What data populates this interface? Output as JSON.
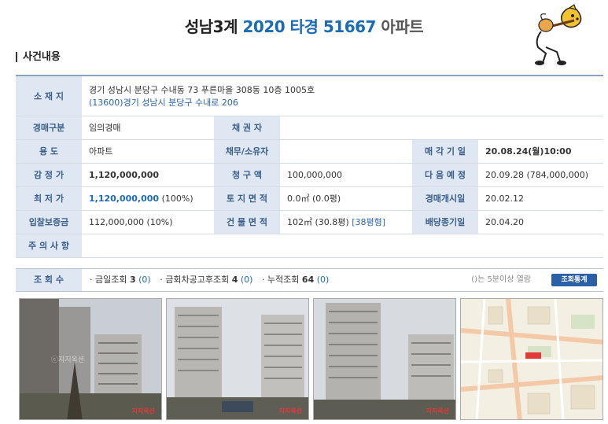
{
  "header": {
    "title_part1": "성남3계",
    "title_part2": "2020 타경 51667",
    "title_part3": "아파트"
  },
  "section_title": "사건내용",
  "info": {
    "location_label": "소 재 지",
    "location_line1": "경기 성남시 분당구 수내동 73 푸른마을 308동 10층 1005호",
    "location_line2": "(13600)경기 성남시 분당구 수내로 206",
    "auction_type_label": "경매구분",
    "auction_type_value": "임의경매",
    "creditor_label": "채 권 자",
    "creditor_value": "",
    "usage_label": "용 도",
    "usage_value": "아파트",
    "debtor_label": "채무/소유자",
    "debtor_value": "",
    "sale_date_label": "매 각 기 일",
    "sale_date_value": "20.08.24(월)10:00",
    "appraisal_label": "감 정 가",
    "appraisal_value": "1,120,000,000",
    "claim_label": "청 구 액",
    "claim_value": "100,000,000",
    "next_label": "다 음 예 정",
    "next_value": "20.09.28 (784,000,000)",
    "min_price_label": "최 저 가",
    "min_price_value": "1,120,000,000",
    "min_price_pct": "(100%)",
    "land_area_label": "토 지 면 적",
    "land_area_value": "0.0㎡ (0.0평)",
    "start_label": "경매개시일",
    "start_value": "20.02.12",
    "deposit_label": "입찰보증금",
    "deposit_value": "112,000,000 (10%)",
    "building_area_label": "건 물 면 적",
    "building_area_value": "102㎡ (30.8평)",
    "building_area_link": "[38평형]",
    "dividend_label": "배당종기일",
    "dividend_value": "20.04.20",
    "notes_label": "주 의 사 항",
    "notes_value": ""
  },
  "views": {
    "label": "조 회 수",
    "today_label": "· 금일조회",
    "today_count": "3",
    "today_sub": "(0)",
    "after_notice_label": "· 금회차공고후조회",
    "after_notice_count": "4",
    "after_notice_sub": "(0)",
    "total_label": "· 누적조회",
    "total_count": "64",
    "total_sub": "(0)",
    "note": "()는 5분이상 열람",
    "stats_button": "조회통계"
  },
  "photos": {
    "mark": "지지옥션",
    "watermark": "ⓒ지지옥션"
  },
  "colors": {
    "accent": "#1a6bb5",
    "header_cell_bg": "#dfe8f2",
    "header_cell_text": "#3b5d88",
    "button_bg": "#2b5fa8"
  }
}
